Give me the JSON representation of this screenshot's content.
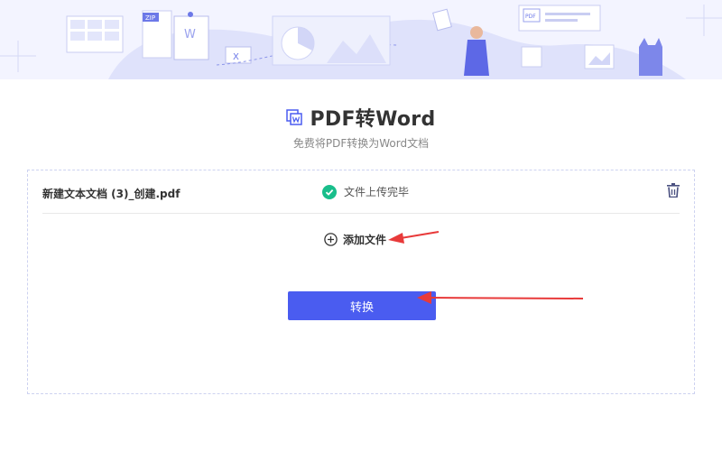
{
  "page": {
    "title": "PDF转Word",
    "subtitle": "免费将PDF转换为Word文档"
  },
  "banner": {
    "illustration_labels": {
      "zip": "ZIP",
      "word": "W",
      "excel": "X",
      "pdf": "PDF"
    }
  },
  "upload": {
    "files": [
      {
        "name": "新建文本文档 (3)_创建.pdf",
        "status": "文件上传完毕",
        "status_icon": "check-circle-icon"
      }
    ],
    "add_file_label": "添加文件",
    "convert_label": "转换"
  },
  "colors": {
    "accent": "#4a5cf0",
    "success": "#19be8b",
    "annotation_arrow": "#e83a3a",
    "banner_bg": "#f3f4ff"
  }
}
